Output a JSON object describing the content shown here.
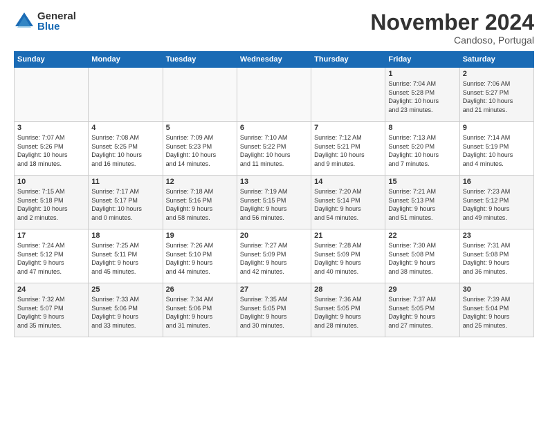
{
  "logo": {
    "general": "General",
    "blue": "Blue"
  },
  "title": "November 2024",
  "location": "Candoso, Portugal",
  "weekdays": [
    "Sunday",
    "Monday",
    "Tuesday",
    "Wednesday",
    "Thursday",
    "Friday",
    "Saturday"
  ],
  "weeks": [
    [
      {
        "day": "",
        "info": ""
      },
      {
        "day": "",
        "info": ""
      },
      {
        "day": "",
        "info": ""
      },
      {
        "day": "",
        "info": ""
      },
      {
        "day": "",
        "info": ""
      },
      {
        "day": "1",
        "info": "Sunrise: 7:04 AM\nSunset: 5:28 PM\nDaylight: 10 hours\nand 23 minutes."
      },
      {
        "day": "2",
        "info": "Sunrise: 7:06 AM\nSunset: 5:27 PM\nDaylight: 10 hours\nand 21 minutes."
      }
    ],
    [
      {
        "day": "3",
        "info": "Sunrise: 7:07 AM\nSunset: 5:26 PM\nDaylight: 10 hours\nand 18 minutes."
      },
      {
        "day": "4",
        "info": "Sunrise: 7:08 AM\nSunset: 5:25 PM\nDaylight: 10 hours\nand 16 minutes."
      },
      {
        "day": "5",
        "info": "Sunrise: 7:09 AM\nSunset: 5:23 PM\nDaylight: 10 hours\nand 14 minutes."
      },
      {
        "day": "6",
        "info": "Sunrise: 7:10 AM\nSunset: 5:22 PM\nDaylight: 10 hours\nand 11 minutes."
      },
      {
        "day": "7",
        "info": "Sunrise: 7:12 AM\nSunset: 5:21 PM\nDaylight: 10 hours\nand 9 minutes."
      },
      {
        "day": "8",
        "info": "Sunrise: 7:13 AM\nSunset: 5:20 PM\nDaylight: 10 hours\nand 7 minutes."
      },
      {
        "day": "9",
        "info": "Sunrise: 7:14 AM\nSunset: 5:19 PM\nDaylight: 10 hours\nand 4 minutes."
      }
    ],
    [
      {
        "day": "10",
        "info": "Sunrise: 7:15 AM\nSunset: 5:18 PM\nDaylight: 10 hours\nand 2 minutes."
      },
      {
        "day": "11",
        "info": "Sunrise: 7:17 AM\nSunset: 5:17 PM\nDaylight: 10 hours\nand 0 minutes."
      },
      {
        "day": "12",
        "info": "Sunrise: 7:18 AM\nSunset: 5:16 PM\nDaylight: 9 hours\nand 58 minutes."
      },
      {
        "day": "13",
        "info": "Sunrise: 7:19 AM\nSunset: 5:15 PM\nDaylight: 9 hours\nand 56 minutes."
      },
      {
        "day": "14",
        "info": "Sunrise: 7:20 AM\nSunset: 5:14 PM\nDaylight: 9 hours\nand 54 minutes."
      },
      {
        "day": "15",
        "info": "Sunrise: 7:21 AM\nSunset: 5:13 PM\nDaylight: 9 hours\nand 51 minutes."
      },
      {
        "day": "16",
        "info": "Sunrise: 7:23 AM\nSunset: 5:12 PM\nDaylight: 9 hours\nand 49 minutes."
      }
    ],
    [
      {
        "day": "17",
        "info": "Sunrise: 7:24 AM\nSunset: 5:12 PM\nDaylight: 9 hours\nand 47 minutes."
      },
      {
        "day": "18",
        "info": "Sunrise: 7:25 AM\nSunset: 5:11 PM\nDaylight: 9 hours\nand 45 minutes."
      },
      {
        "day": "19",
        "info": "Sunrise: 7:26 AM\nSunset: 5:10 PM\nDaylight: 9 hours\nand 44 minutes."
      },
      {
        "day": "20",
        "info": "Sunrise: 7:27 AM\nSunset: 5:09 PM\nDaylight: 9 hours\nand 42 minutes."
      },
      {
        "day": "21",
        "info": "Sunrise: 7:28 AM\nSunset: 5:09 PM\nDaylight: 9 hours\nand 40 minutes."
      },
      {
        "day": "22",
        "info": "Sunrise: 7:30 AM\nSunset: 5:08 PM\nDaylight: 9 hours\nand 38 minutes."
      },
      {
        "day": "23",
        "info": "Sunrise: 7:31 AM\nSunset: 5:08 PM\nDaylight: 9 hours\nand 36 minutes."
      }
    ],
    [
      {
        "day": "24",
        "info": "Sunrise: 7:32 AM\nSunset: 5:07 PM\nDaylight: 9 hours\nand 35 minutes."
      },
      {
        "day": "25",
        "info": "Sunrise: 7:33 AM\nSunset: 5:06 PM\nDaylight: 9 hours\nand 33 minutes."
      },
      {
        "day": "26",
        "info": "Sunrise: 7:34 AM\nSunset: 5:06 PM\nDaylight: 9 hours\nand 31 minutes."
      },
      {
        "day": "27",
        "info": "Sunrise: 7:35 AM\nSunset: 5:05 PM\nDaylight: 9 hours\nand 30 minutes."
      },
      {
        "day": "28",
        "info": "Sunrise: 7:36 AM\nSunset: 5:05 PM\nDaylight: 9 hours\nand 28 minutes."
      },
      {
        "day": "29",
        "info": "Sunrise: 7:37 AM\nSunset: 5:05 PM\nDaylight: 9 hours\nand 27 minutes."
      },
      {
        "day": "30",
        "info": "Sunrise: 7:39 AM\nSunset: 5:04 PM\nDaylight: 9 hours\nand 25 minutes."
      }
    ]
  ]
}
